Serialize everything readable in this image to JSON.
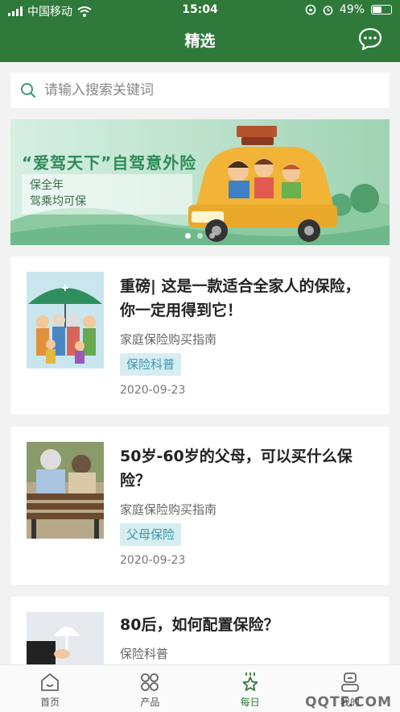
{
  "status": {
    "carrier": "中国移动",
    "time": "15:04",
    "battery": "49%"
  },
  "header": {
    "title": "精选"
  },
  "search": {
    "placeholder": "请输入搜索关键词"
  },
  "banner": {
    "headline": "“爱驾天下”自驾意外险",
    "line1": "保全年",
    "line2": "驾乘均可保",
    "slides": 3,
    "active_slide": 0
  },
  "articles": [
    {
      "title": "重磅| 这是一款适合全家人的保险，你一定用得到它！",
      "category": "家庭保险购买指南",
      "tag": "保险科普",
      "date": "2020-09-23"
    },
    {
      "title": "50岁-60岁的父母，可以买什么保险？",
      "category": "家庭保险购买指南",
      "tag": "父母保险",
      "date": "2020-09-23"
    },
    {
      "title": "80后，如何配置保险？",
      "category": "保险科普"
    }
  ],
  "tabs": [
    {
      "label": "首页",
      "icon": "home-icon"
    },
    {
      "label": "产品",
      "icon": "grid-icon"
    },
    {
      "label": "每日",
      "icon": "star-icon",
      "active": true
    },
    {
      "label": "我的",
      "icon": "profile-icon"
    }
  ],
  "watermark": "QQTF.COM",
  "colors": {
    "primary": "#2f7a3a",
    "tag_bg": "#d6eef2",
    "tag_text": "#3e96b0"
  }
}
